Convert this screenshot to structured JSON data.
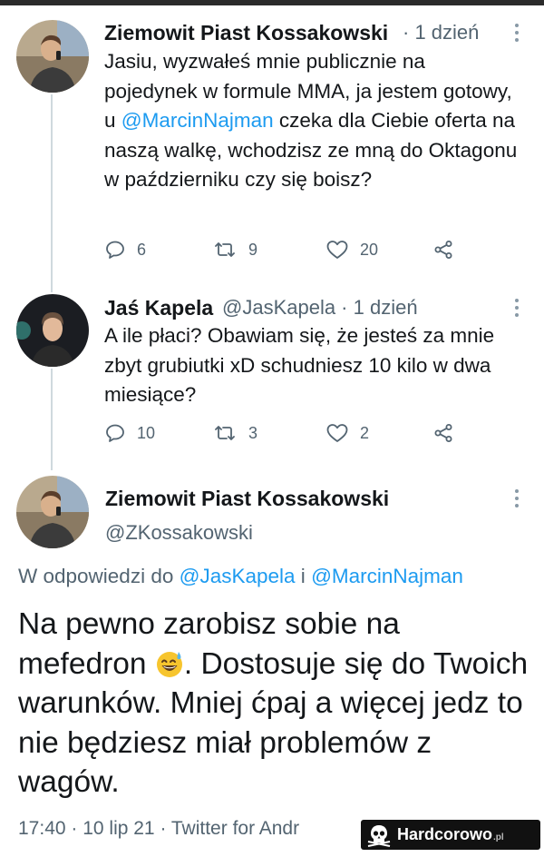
{
  "colors": {
    "link": "#1d9bf0",
    "secondary": "#536471",
    "text": "#14171a",
    "thread_line": "#cfd9de"
  },
  "tweets": [
    {
      "author": "Ziemowit Piast Kossakowski",
      "meta": "· 1 dzień",
      "text_parts": [
        "Jasiu, wyzwałeś mnie publicznie na pojedynek w formule MMA, ja jestem gotowy, u ",
        "@MarcinNajman",
        " czeka dla Ciebie oferta na naszą walkę, wchodzisz ze mną do Oktagonu w październiku czy się boisz?"
      ],
      "replies": "6",
      "retweets": "9",
      "likes": "20"
    },
    {
      "author": "Jaś Kapela",
      "meta": "@JasKapela · 1 dzień",
      "text": "A ile płaci? Obawiam się, że jesteś za mnie zbyt grubiutki xD schudniesz 10 kilo w dwa miesiące?",
      "replies": "10",
      "retweets": "3",
      "likes": "2"
    }
  ],
  "main_tweet": {
    "author": "Ziemowit Piast Kossakowski",
    "handle": "@ZKossakowski",
    "replying_prefix": "W odpowiedzi do",
    "replying_user1": "@JasKapela",
    "replying_and": "i",
    "replying_user2": "@MarcinNajman",
    "text_part1": "Na pewno zarobisz sobie na mefedron",
    "emoji": "sweat-smile-emoji",
    "text_part2": ". Dostosuje się do Twoich warunków. Mniej ćpaj a więcej jedz to nie będziesz miał problemów z wagów.",
    "footer": "17:40 · 10 lip 21 · Twitter for Andr"
  },
  "watermark": {
    "brand": "Hardcorowo",
    "suffix": ".pl"
  },
  "icons": [
    "reply-icon",
    "retweet-icon",
    "like-icon",
    "share-icon",
    "more-icon"
  ]
}
